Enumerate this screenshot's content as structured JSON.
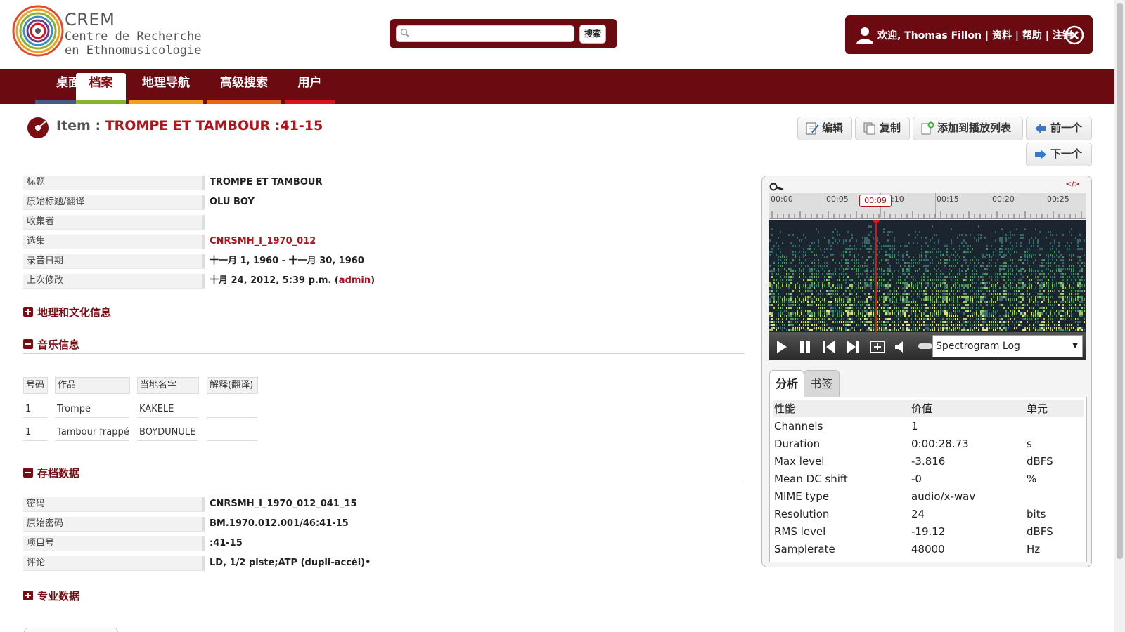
{
  "logo": {
    "title": "CREM",
    "subtitle_line1": "Centre de Recherche",
    "subtitle_line2": "en Ethnomusicologie"
  },
  "search": {
    "placeholder": "",
    "value": "",
    "button_label": "搜索"
  },
  "user": {
    "welcome": "欢迎, Thomas Fillon",
    "links": [
      "资料",
      "帮助",
      "注销"
    ],
    "separator": " | "
  },
  "nav": {
    "tabs": [
      {
        "label": "桌面",
        "color": "#4a5a7e"
      },
      {
        "label": "档案",
        "color": "#8ab22e"
      },
      {
        "label": "地理导航",
        "color": "#f0a11b"
      },
      {
        "label": "高级搜索",
        "color": "#e4671b"
      },
      {
        "label": "用户",
        "color": "#d9121b"
      }
    ],
    "active_index": 1
  },
  "item": {
    "prefix": "Item : ",
    "title": "TROMPE ET TAMBOUR :41-15"
  },
  "actions": {
    "edit": "编辑",
    "copy": "复制",
    "add_playlist": "添加到播放列表",
    "previous": "前一个",
    "next": "下一个"
  },
  "fields": [
    {
      "label": "标题",
      "value": "TROMPE ET TAMBOUR"
    },
    {
      "label": "原始标题/翻译",
      "value": "OLU BOY"
    },
    {
      "label": "收集者",
      "value": ""
    },
    {
      "label": "选集",
      "value": "CNRSMH_I_1970_012",
      "link": true
    },
    {
      "label": "录音日期",
      "value": "十一月 1, 1960 - 十一月 30, 1960"
    },
    {
      "label": "上次修改",
      "value": "十月 24, 2012, 5:39 p.m. (",
      "link_text": "admin",
      "suffix": ")"
    }
  ],
  "sections": {
    "geo": "地理和文化信息",
    "music": "音乐信息",
    "archive": "存档数据",
    "specialist": "专业数据"
  },
  "music_table": {
    "headers": [
      "号码",
      "作品",
      "当地名字",
      "解释(翻译)"
    ],
    "rows": [
      [
        "1",
        "Trompe",
        "KAKELE",
        ""
      ],
      [
        "1",
        "Tambour frappé",
        "BOYDUNULE",
        ""
      ]
    ]
  },
  "archive_fields": [
    {
      "label": "密码",
      "value": "CNRSMH_I_1970_012_041_15"
    },
    {
      "label": "原始密码",
      "value": "BM.1970.012.001/46:41-15"
    },
    {
      "label": "项目号",
      "value": ":41-15"
    },
    {
      "label": "评论",
      "value": "LD, 1/2 piste;ATP (dupli-accèl)•"
    }
  ],
  "player": {
    "embed_label": "</>",
    "time_labels": [
      "00:00",
      "00:05",
      "00:10",
      "00:15",
      "00:20",
      "00:25"
    ],
    "cursor_time": "00:09",
    "view_mode": "Spectrogram Log",
    "tabs": [
      "分析",
      "书签"
    ],
    "active_tab": 0
  },
  "analysis": {
    "headers": [
      "性能",
      "价值",
      "单元"
    ],
    "rows": [
      [
        "Channels",
        "1",
        ""
      ],
      [
        "Duration",
        "0:00:28.73",
        "s"
      ],
      [
        "Max level",
        "-3.816",
        "dBFS"
      ],
      [
        "Mean DC shift",
        "-0",
        "%"
      ],
      [
        "MIME type",
        "audio/x-wav",
        ""
      ],
      [
        "Resolution",
        "24",
        "bits"
      ],
      [
        "RMS level",
        "-19.12",
        "dBFS"
      ],
      [
        "Samplerate",
        "48000",
        "Hz"
      ]
    ]
  },
  "colors": {
    "brand": "#6b0a10",
    "accent_red": "#b5121b"
  }
}
